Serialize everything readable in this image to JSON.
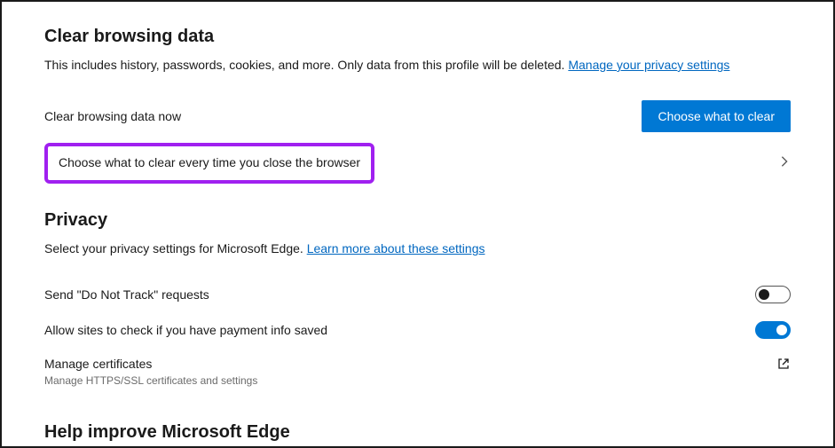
{
  "clearData": {
    "title": "Clear browsing data",
    "desc": "This includes history, passwords, cookies, and more. Only data from this profile will be deleted. ",
    "manageLink": "Manage your privacy settings",
    "nowLabel": "Clear browsing data now",
    "chooseButton": "Choose what to clear",
    "closeLabel": "Choose what to clear every time you close the browser"
  },
  "privacy": {
    "title": "Privacy",
    "desc": "Select your privacy settings for Microsoft Edge. ",
    "learnLink": "Learn more about these settings",
    "dntLabel": "Send \"Do Not Track\" requests",
    "paymentLabel": "Allow sites to check if you have payment info saved",
    "certLabel": "Manage certificates",
    "certSub": "Manage HTTPS/SSL certificates and settings"
  },
  "help": {
    "title": "Help improve Microsoft Edge"
  }
}
